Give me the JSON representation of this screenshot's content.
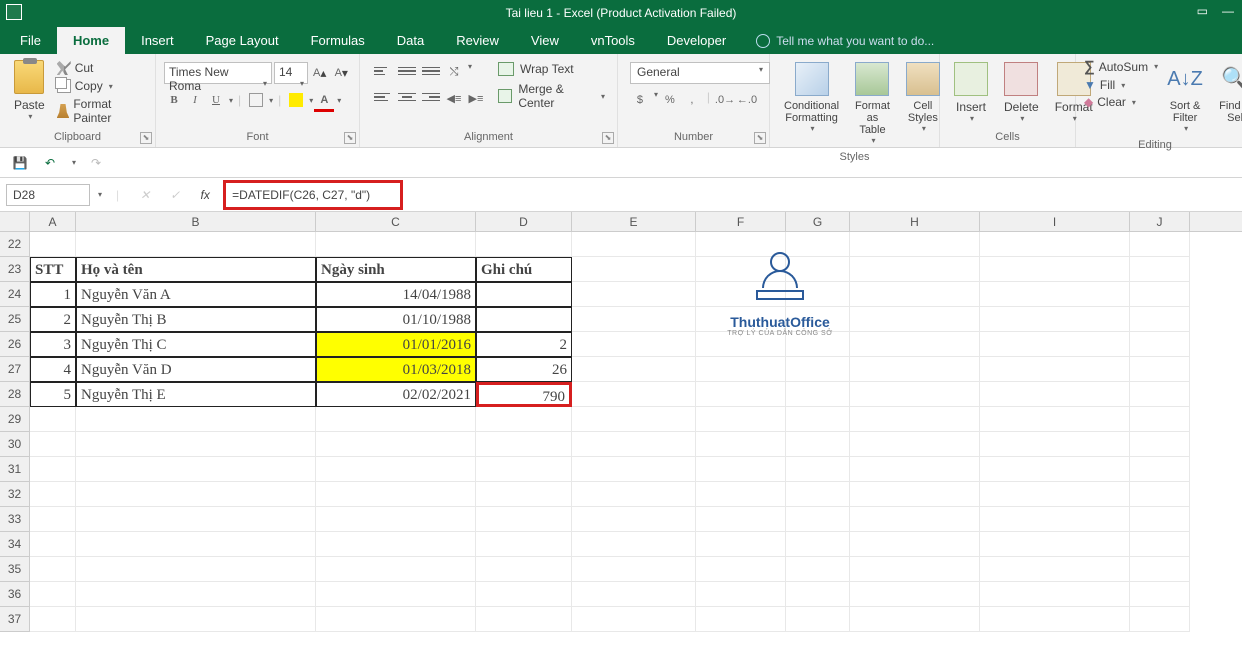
{
  "title": "Tai lieu 1 - Excel (Product Activation Failed)",
  "menu": {
    "file": "File",
    "home": "Home",
    "insert": "Insert",
    "page": "Page Layout",
    "formulas": "Formulas",
    "data": "Data",
    "review": "Review",
    "view": "View",
    "vntools": "vnTools",
    "developer": "Developer",
    "tellme": "Tell me what you want to do..."
  },
  "ribbon": {
    "clipboard": {
      "label": "Clipboard",
      "paste": "Paste",
      "cut": "Cut",
      "copy": "Copy",
      "painter": "Format Painter"
    },
    "font": {
      "label": "Font",
      "name": "Times New Roma",
      "size": "14"
    },
    "alignment": {
      "label": "Alignment",
      "wrap": "Wrap Text",
      "merge": "Merge & Center"
    },
    "number": {
      "label": "Number",
      "format": "General"
    },
    "styles": {
      "label": "Styles",
      "cond": "Conditional Formatting",
      "table": "Format as Table",
      "cell": "Cell Styles"
    },
    "cells": {
      "label": "Cells",
      "insert": "Insert",
      "delete": "Delete",
      "format": "Format"
    },
    "editing": {
      "label": "Editing",
      "autosum": "AutoSum",
      "fill": "Fill",
      "clear": "Clear",
      "sort": "Sort & Filter",
      "find": "Find & Sel"
    }
  },
  "namebox": "D28",
  "formula": "=DATEDIF(C26, C27, \"d\")",
  "cols": [
    "A",
    "B",
    "C",
    "D",
    "E",
    "F",
    "G",
    "H",
    "I",
    "J"
  ],
  "rows": [
    "22",
    "23",
    "24",
    "25",
    "26",
    "27",
    "28",
    "29",
    "30",
    "31",
    "32",
    "33",
    "34",
    "35",
    "36",
    "37"
  ],
  "table": {
    "headers": {
      "stt": "STT",
      "name": "Họ và tên",
      "dob": "Ngày sinh",
      "note": "Ghi chú"
    },
    "data": [
      {
        "stt": "1",
        "name": "Nguyễn Văn A",
        "dob": "14/04/1988",
        "note": ""
      },
      {
        "stt": "2",
        "name": "Nguyễn Thị B",
        "dob": "01/10/1988",
        "note": ""
      },
      {
        "stt": "3",
        "name": "Nguyễn Thị C",
        "dob": "01/01/2016",
        "note": "2"
      },
      {
        "stt": "4",
        "name": "Nguyễn Văn D",
        "dob": "01/03/2018",
        "note": "26"
      },
      {
        "stt": "5",
        "name": "Nguyễn Thị E",
        "dob": "02/02/2021",
        "note": "790"
      }
    ]
  },
  "logo": {
    "title": "ThuthuatOffice",
    "sub": "TRỢ LÝ CỦA DÂN CÔNG SỞ"
  }
}
